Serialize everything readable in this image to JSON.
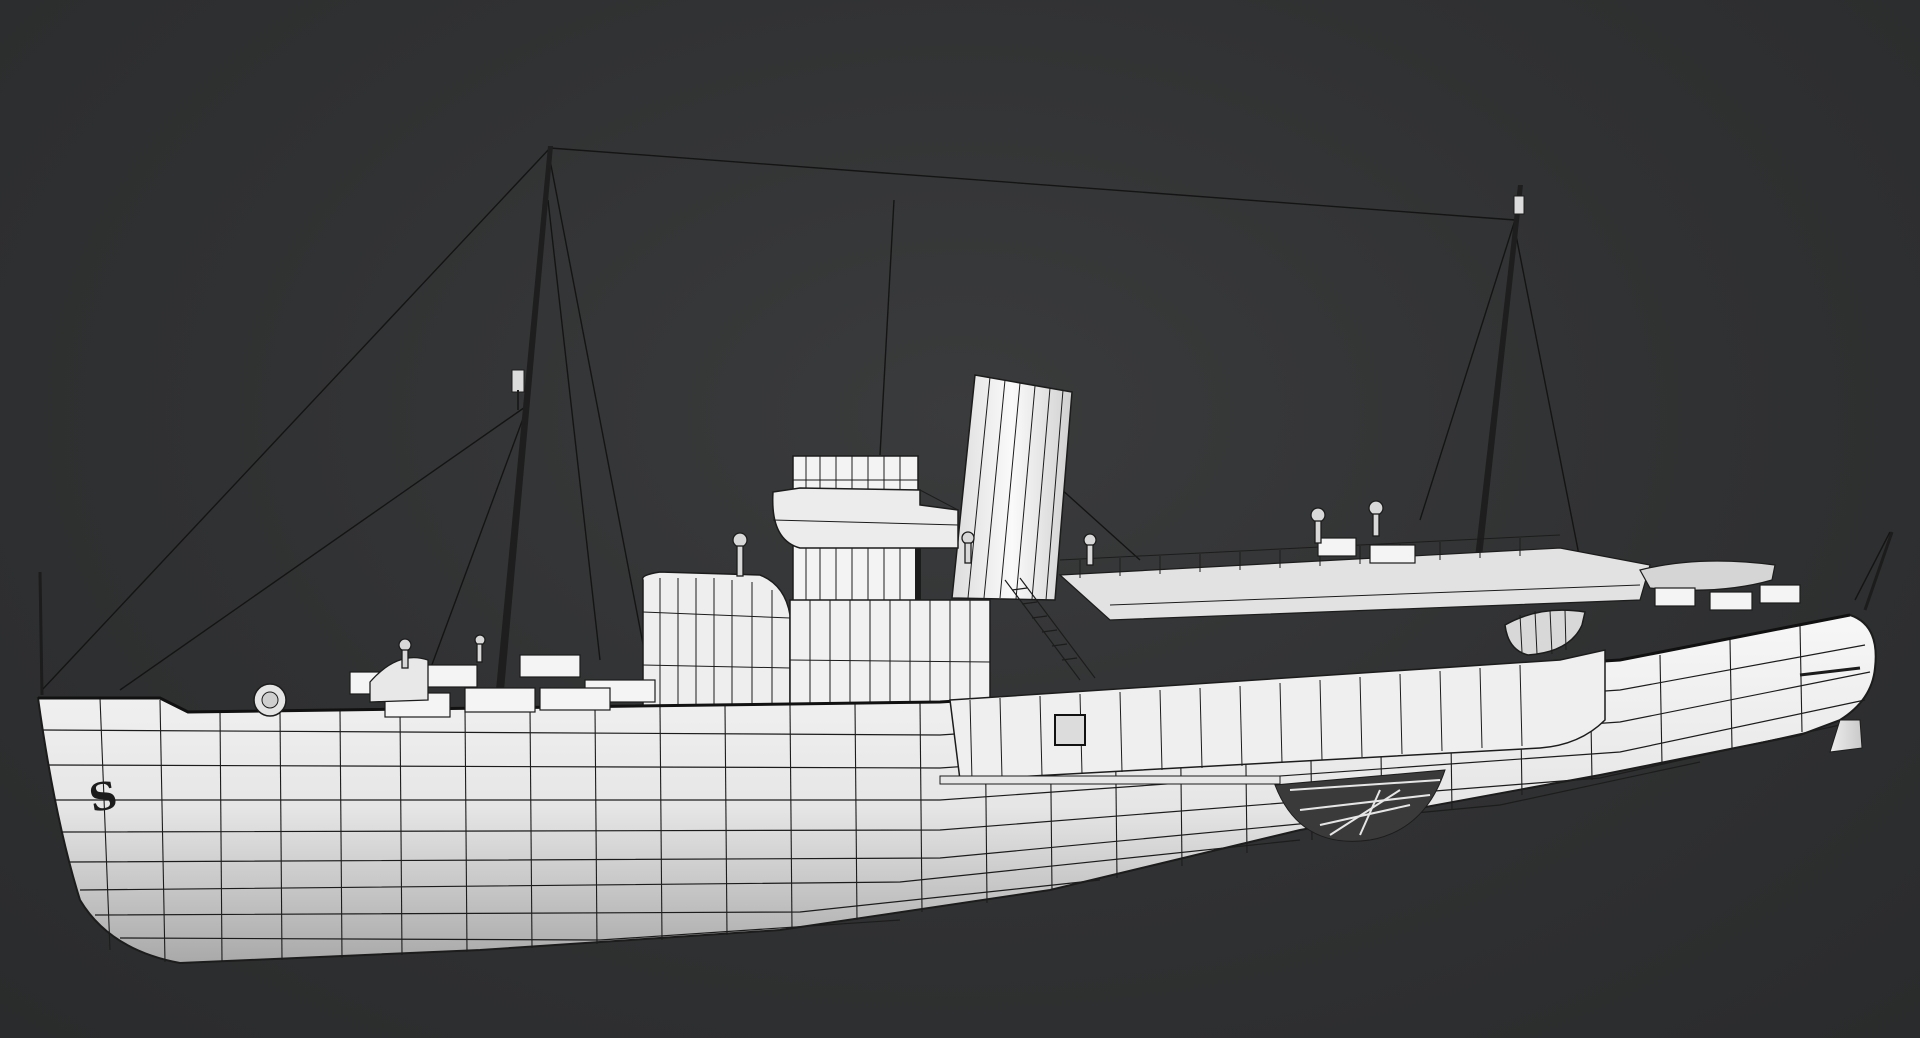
{
  "scene": {
    "subject": "paddle-steamer-wireframe-model",
    "background_color": "#2f3031",
    "hull_color": "#f2f2f2",
    "hull_shade_color": "#bdbdbd",
    "wire_color": "#1c1c1c"
  },
  "hull_emblem": {
    "text": "S"
  }
}
